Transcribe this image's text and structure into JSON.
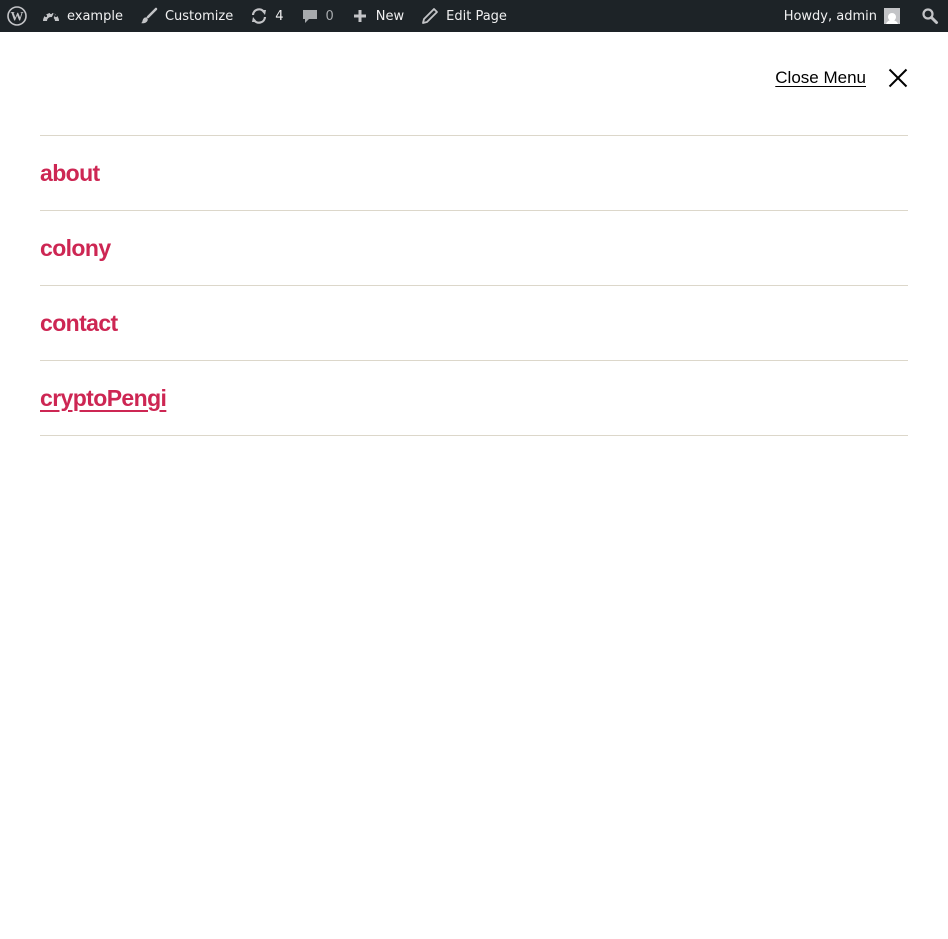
{
  "admin_bar": {
    "site_name": "example",
    "customize_label": "Customize",
    "updates_count": "4",
    "comments_count": "0",
    "new_label": "New",
    "edit_page_label": "Edit Page",
    "howdy_label": "Howdy, admin"
  },
  "header": {
    "close_menu_label": "Close Menu"
  },
  "menu": {
    "items": [
      {
        "label": "about"
      },
      {
        "label": "colony"
      },
      {
        "label": "contact"
      },
      {
        "label": "cryptoPengi"
      }
    ]
  },
  "colors": {
    "admin_bar_bg": "#1d2327",
    "link_accent": "#cd2653",
    "divider": "#dcd7ca"
  }
}
